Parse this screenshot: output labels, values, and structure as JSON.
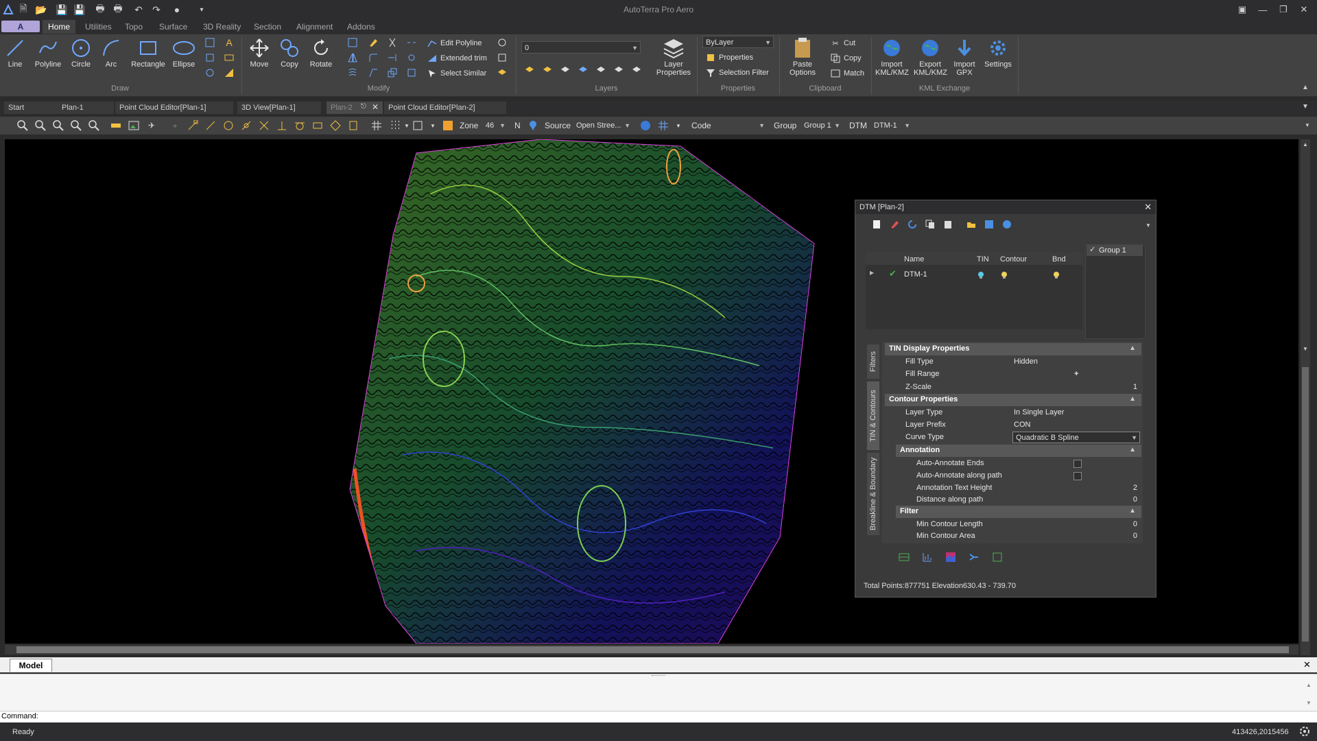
{
  "app": {
    "title": "AutoTerra Pro Aero"
  },
  "menu_tabs": [
    {
      "label": "Home"
    },
    {
      "label": "Utilities"
    },
    {
      "label": "Topo"
    },
    {
      "label": "Surface"
    },
    {
      "label": "3D Reality"
    },
    {
      "label": "Section"
    },
    {
      "label": "Alignment"
    },
    {
      "label": "Addons"
    }
  ],
  "ribbon": {
    "draw": {
      "group_label": "Draw",
      "line": "Line",
      "polyline": "Polyline",
      "circle": "Circle",
      "arc": "Arc",
      "rectangle": "Rectangle",
      "ellipse": "Ellipse"
    },
    "modify": {
      "group_label": "Modify",
      "move": "Move",
      "copy": "Copy",
      "rotate": "Rotate",
      "edit_polyline": "Edit Polyline",
      "extended_trim": "Extended trim",
      "select_similar": "Select Similar"
    },
    "layers": {
      "group_label": "Layers",
      "current_layer": "0",
      "layer_properties_l1": "Layer",
      "layer_properties_l2": "Properties"
    },
    "properties": {
      "group_label": "Properties",
      "bylayer": "ByLayer",
      "properties": "Properties",
      "selection_filter": "Selection Filter"
    },
    "clipboard": {
      "group_label": "Clipboard",
      "paste_l1": "Paste",
      "paste_l2": "Options",
      "cut": "Cut",
      "copy": "Copy",
      "match": "Match"
    },
    "kml": {
      "group_label": "KML Exchange",
      "import_l1": "Import",
      "import_l2": "KML/KMZ",
      "export_l1": "Export",
      "export_l2": "KML/KMZ",
      "gpx_l1": "Import",
      "gpx_l2": "GPX",
      "settings": "Settings"
    }
  },
  "doc_tabs": [
    {
      "label": "Start"
    },
    {
      "label": "Plan-1"
    },
    {
      "label": "Point Cloud Editor[Plan-1]"
    },
    {
      "label": "3D View[Plan-1]"
    },
    {
      "label": "Plan-2"
    },
    {
      "label": "Point Cloud Editor[Plan-2]"
    }
  ],
  "toolbar": {
    "zone_label": "Zone",
    "zone_value": "46",
    "n_label": "N",
    "source_label": "Source",
    "source_value": "Open Stree...",
    "code_label": "Code",
    "code_value": "",
    "group_label": "Group",
    "group_value": "Group 1",
    "dtm_label": "DTM",
    "dtm_value": "DTM-1"
  },
  "dtm_panel": {
    "title": "DTM [Plan-2]",
    "columns": {
      "name": "Name",
      "tin": "TIN",
      "contour": "Contour",
      "bnd": "Bnd"
    },
    "rows": [
      {
        "name": "DTM-1"
      }
    ],
    "group_item": "Group 1",
    "side_tabs": {
      "filters": "Filters",
      "tin_contours": "TIN & Contours",
      "breakline": "Breakline & Boundary"
    },
    "tin_display": {
      "header": "TIN Display Properties",
      "fill_type_k": "Fill Type",
      "fill_type_v": "Hidden",
      "fill_range_k": "Fill Range",
      "fill_range_v": "+",
      "z_scale_k": "Z-Scale",
      "z_scale_v": "1"
    },
    "contour": {
      "header": "Contour Properties",
      "layer_type_k": "Layer Type",
      "layer_type_v": "In Single Layer",
      "layer_prefix_k": "Layer Prefix",
      "layer_prefix_v": "CON",
      "curve_type_k": "Curve Type",
      "curve_type_v": "Quadratic B Spline"
    },
    "annotation": {
      "header": "Annotation",
      "ends_k": "Auto-Annotate Ends",
      "path_k": "Auto-Annotate along path",
      "height_k": "Annotation Text Height",
      "height_v": "2",
      "distance_k": "Distance along path",
      "distance_v": "0"
    },
    "filter": {
      "header": "Filter",
      "min_length_k": "Min Contour Length",
      "min_length_v": "0",
      "min_area_k": "Min Contour Area",
      "min_area_v": "0"
    },
    "status": "Total Points:877751 Elevation630.43 - 739.70"
  },
  "model_tab": "Model",
  "command_label": "Command:",
  "status": {
    "ready": "Ready",
    "coords": "413426,2015456"
  },
  "colors": {
    "accent": "#b0a4d8",
    "ribbon_bg": "#424242",
    "canvas_bg": "#000000"
  }
}
